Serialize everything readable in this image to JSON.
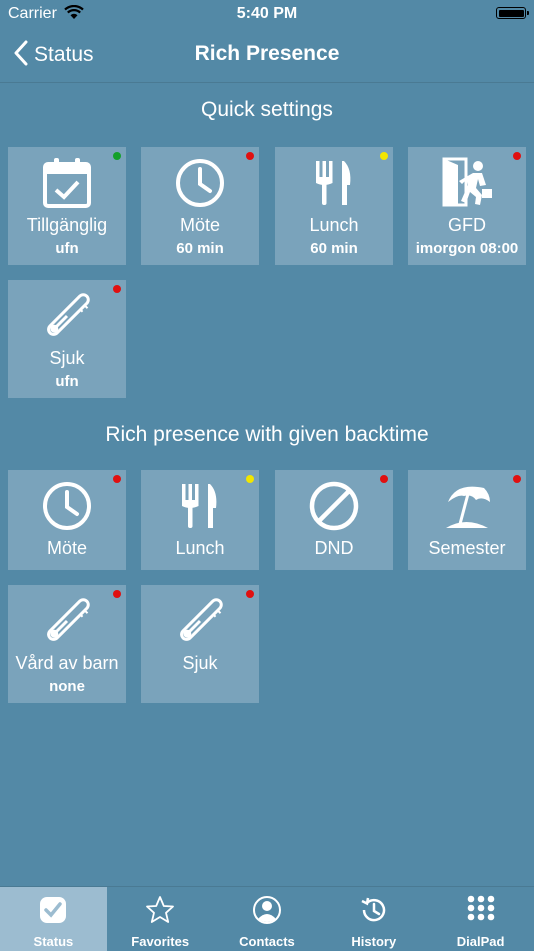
{
  "status_bar": {
    "carrier": "Carrier",
    "time": "5:40 PM"
  },
  "nav": {
    "back_label": "Status",
    "title": "Rich Presence"
  },
  "quick": {
    "title": "Quick settings",
    "tiles": [
      {
        "label": "Tillgänglig",
        "sub": "ufn",
        "icon": "calendar-check-icon",
        "dot": "#14a02a"
      },
      {
        "label": "Möte",
        "sub": "60 min",
        "icon": "clock-icon",
        "dot": "#e01010"
      },
      {
        "label": "Lunch",
        "sub": "60 min",
        "icon": "fork-knife-icon",
        "dot": "#f2e600"
      },
      {
        "label": "GFD",
        "sub": "imorgon 08:00",
        "icon": "exit-door-icon",
        "dot": "#e01010"
      },
      {
        "label": "Sjuk",
        "sub": "ufn",
        "icon": "thermometer-icon",
        "dot": "#e01010"
      }
    ]
  },
  "backtime": {
    "title": "Rich presence with given backtime",
    "tiles": [
      {
        "label": "Möte",
        "icon": "clock-icon",
        "dot": "#e01010"
      },
      {
        "label": "Lunch",
        "icon": "fork-knife-icon",
        "dot": "#f2e600"
      },
      {
        "label": "DND",
        "icon": "no-entry-icon",
        "dot": "#e01010"
      },
      {
        "label": "Semester",
        "icon": "beach-umbrella-icon",
        "dot": "#e01010"
      },
      {
        "label": "Vård av barn",
        "sub": "none",
        "icon": "thermometer-icon",
        "dot": "#e01010"
      },
      {
        "label": "Sjuk",
        "icon": "thermometer-icon",
        "dot": "#e01010"
      }
    ]
  },
  "tabs": [
    {
      "label": "Status",
      "icon": "status-check-icon",
      "active": true
    },
    {
      "label": "Favorites",
      "icon": "star-icon",
      "active": false
    },
    {
      "label": "Contacts",
      "icon": "contact-person-icon",
      "active": false
    },
    {
      "label": "History",
      "icon": "history-clock-icon",
      "active": false
    },
    {
      "label": "DialPad",
      "icon": "dialpad-grid-icon",
      "active": false
    }
  ],
  "colors": {
    "background": "#5389a6",
    "tile": "#7aa3bb",
    "active_tab": "#9cbcd0"
  }
}
